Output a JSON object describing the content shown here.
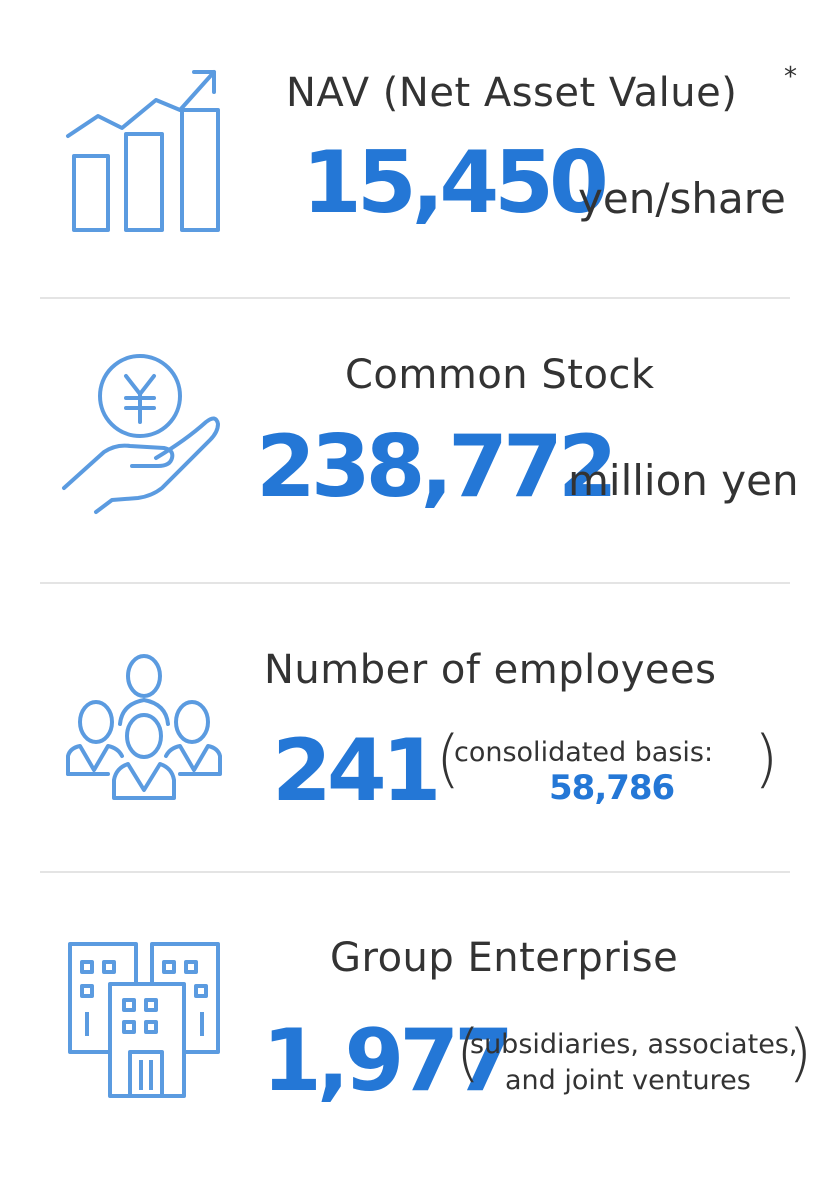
{
  "nav": {
    "label": "NAV (Net Asset Value)",
    "marker": "*",
    "value": "15,450",
    "unit": "yen/share",
    "icon": "bar-chart-growth-icon"
  },
  "common_stock": {
    "label": "Common Stock",
    "value": "238,772",
    "unit": "million yen",
    "icon": "yen-coin-hand-icon"
  },
  "employees": {
    "label": "Number of employees",
    "value": "241",
    "paren_open": "(",
    "note": "consolidated basis:",
    "note_value": "58,786",
    "paren_close": ")",
    "icon": "people-group-icon"
  },
  "group": {
    "label": "Group Enterprise",
    "value": "1,977",
    "paren_open": "(",
    "note_line1": "subsidiaries, associates,",
    "note_line2": "and joint ventures",
    "paren_close": ")",
    "icon": "office-building-icon"
  },
  "colors": {
    "accent": "#2477d6",
    "icon": "#5b9be0",
    "text": "#333333",
    "divider": "#e4e4e4"
  }
}
